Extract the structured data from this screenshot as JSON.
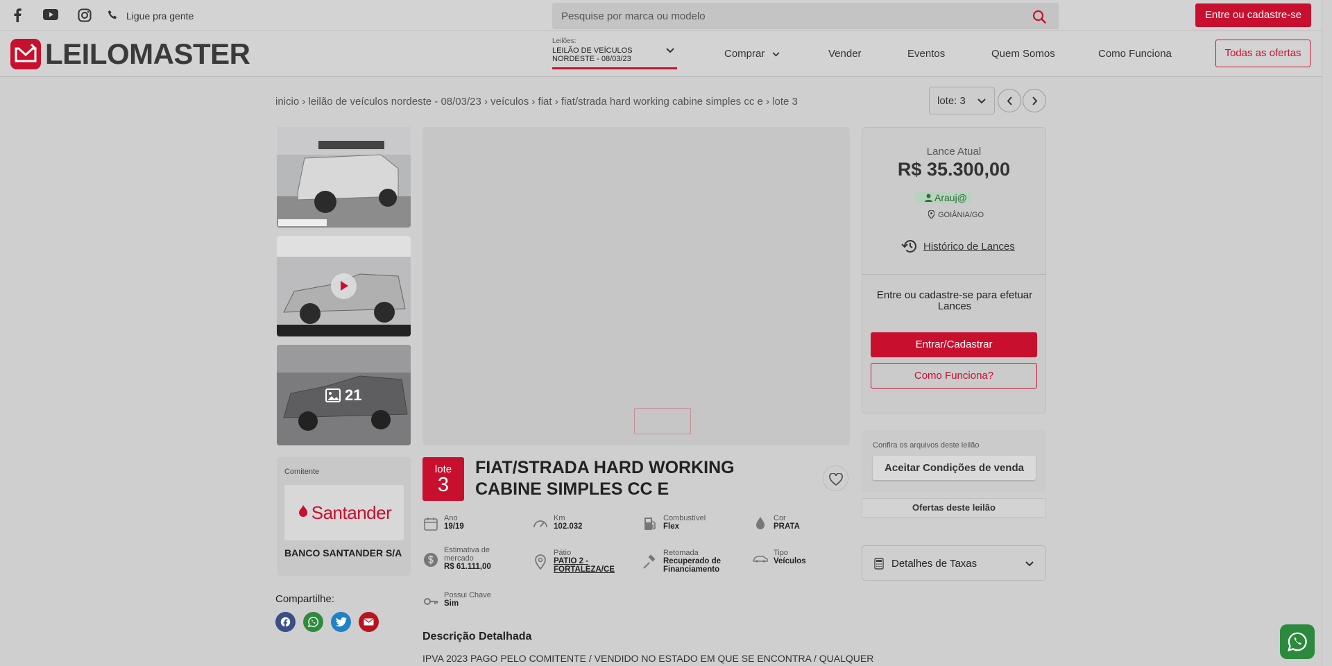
{
  "topbar": {
    "phone_label": "Ligue pra gente",
    "search_placeholder": "Pesquise por marca ou modelo",
    "login_label": "Entre ou cadastre-se"
  },
  "navbar": {
    "logo_text": "LEILOMASTER",
    "auction_caption": "Leilões:",
    "auction_line1": "LEILÃO DE VEÍCULOS",
    "auction_line2": "NORDESTE - 08/03/23",
    "items": [
      "Comprar",
      "Vender",
      "Eventos",
      "Quem Somos",
      "Como Funciona"
    ],
    "all_offers": "Todas as ofertas"
  },
  "breadcrumb": "inicio › leilão de veículos nordeste - 08/03/23 › veículos › fiat › fiat/strada hard working cabine simples cc e › lote 3",
  "lot_selector": "lote: 3",
  "gallery": {
    "more_count": "21"
  },
  "bid": {
    "title": "Lance Atual",
    "value": "R$ 35.300,00",
    "bidder": "Arauj@",
    "location": "GOIÂNIA/GO",
    "history": "Histórico de Lances",
    "login_msg": "Entre ou cadastre-se para efetuar Lances",
    "enter_btn": "Entrar/Cadastrar",
    "how_btn": "Como Funciona?"
  },
  "files": {
    "caption": "Confira os arquivos deste leilão",
    "conditions_btn": "Aceitar Condições de venda",
    "offers_btn": "Ofertas deste leilão",
    "fees": "Detalhes de Taxas"
  },
  "seller": {
    "label": "Comitente",
    "logo_text": "Santander",
    "name": "BANCO SANTANDER S/A"
  },
  "share_label": "Compartilhe:",
  "lot": {
    "word": "lote",
    "number": "3",
    "title_line1": "FIAT/STRADA HARD WORKING",
    "title_line2": "CABINE SIMPLES CC E"
  },
  "specs": {
    "ano_l": "Ano",
    "ano_v": "19/19",
    "km_l": "Km",
    "km_v": "102.032",
    "comb_l": "Combustível",
    "comb_v": "Flex",
    "cor_l": "Cor",
    "cor_v": "PRATA",
    "est_l1": "Estimativa de",
    "est_l2": "mercado",
    "est_v": "R$ 61.111,00",
    "patio_l": "Pátio",
    "patio_v1": "PATIO 2 -",
    "patio_v2": "FORTALEZA/CE",
    "ret_l": "Retomada",
    "ret_v1": "Recuperado de",
    "ret_v2": "Financiamento",
    "tipo_l": "Tipo",
    "tipo_v": "Veículos",
    "chave_l": "Possui Chave",
    "chave_v": "Sim"
  },
  "description": {
    "title": "Descrição Detalhada",
    "text": "IPVA 2023 PAGO PELO COMITENTE / VENDIDO NO ESTADO EM QUE SE ENCONTRA / QUALQUER"
  }
}
